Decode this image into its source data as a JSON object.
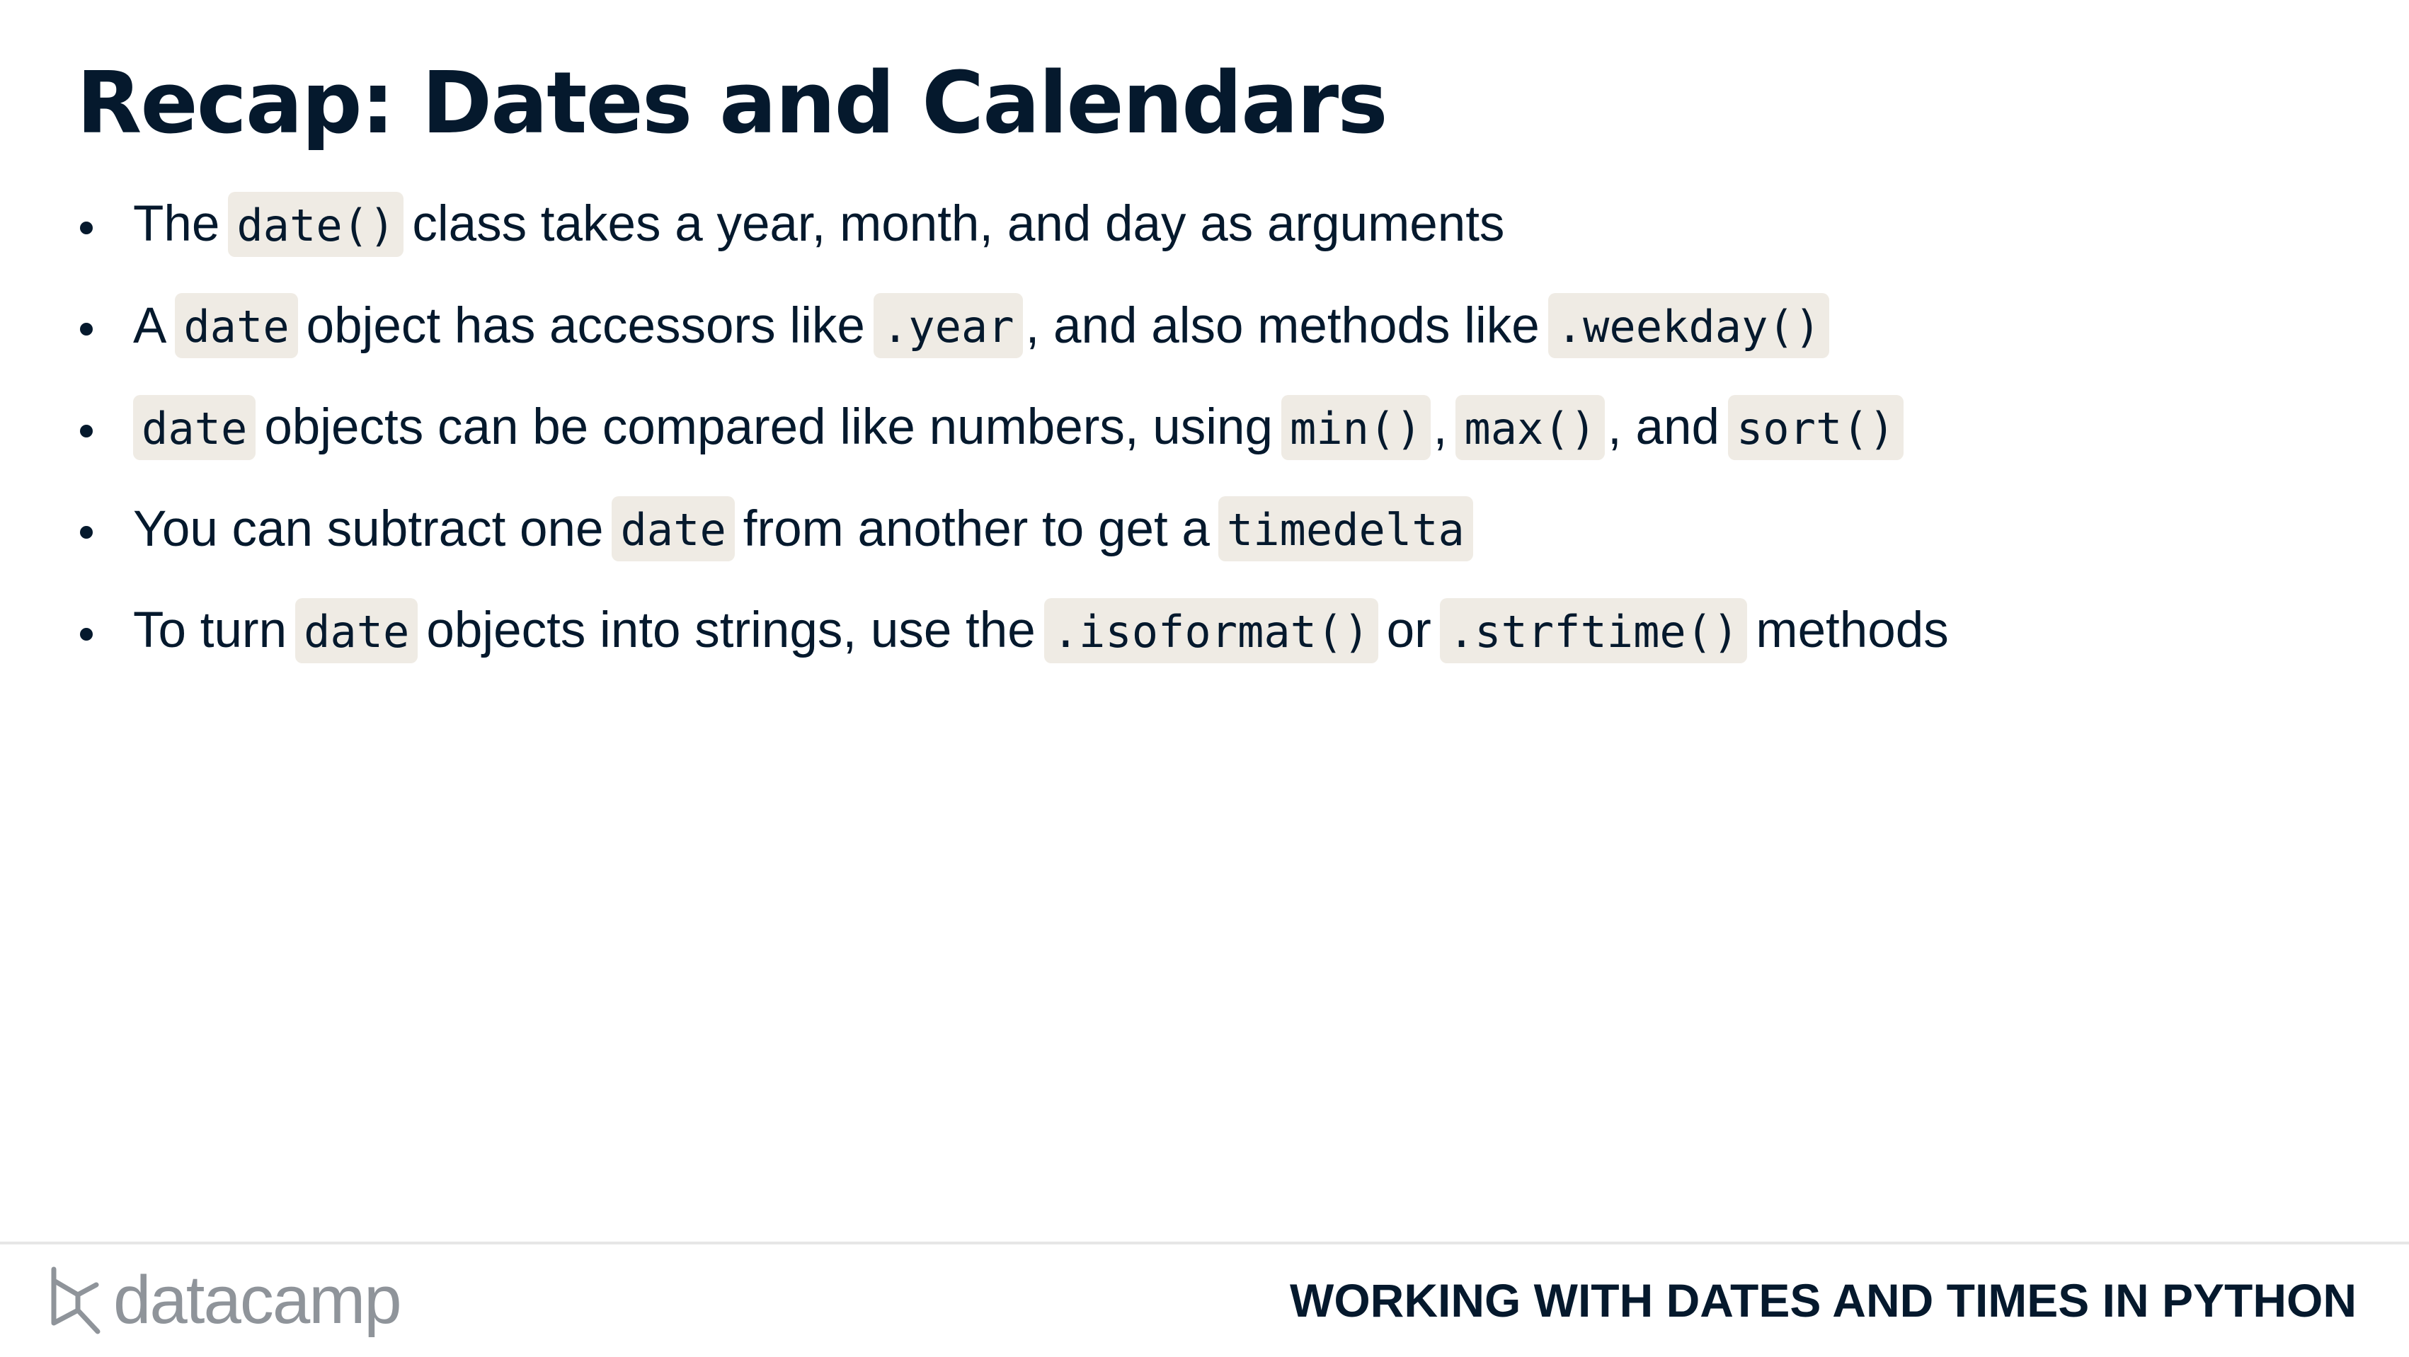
{
  "title": "Recap: Dates and Calendars",
  "bullets": [
    {
      "a": "The",
      "b": "date()",
      "c": "class takes a year, month, and day as arguments"
    },
    {
      "a": "A",
      "b": "date",
      "c": "object has accessors like",
      "d": ".year",
      "e": ", and also methods like",
      "f": ".weekday()"
    },
    {
      "b": "date",
      "c": "objects can be compared like numbers, using",
      "d": "min()",
      "e": ",",
      "f": "max()",
      "g": ", and",
      "h": "sort()"
    },
    {
      "a": "You can subtract one",
      "b": "date",
      "c": "from another to get a",
      "d": "timedelta"
    },
    {
      "a": "To turn",
      "b": "date",
      "c": "objects into strings, use the",
      "d": ".isoformat()",
      "e": "or",
      "f": ".strftime()",
      "g": "methods"
    }
  ],
  "footer": {
    "logo_text": "datacamp",
    "course_title": "WORKING WITH DATES AND TIMES IN PYTHON"
  },
  "colors": {
    "text": "#05192d",
    "code_bg": "#efebe4",
    "logo": "#8f949a"
  }
}
